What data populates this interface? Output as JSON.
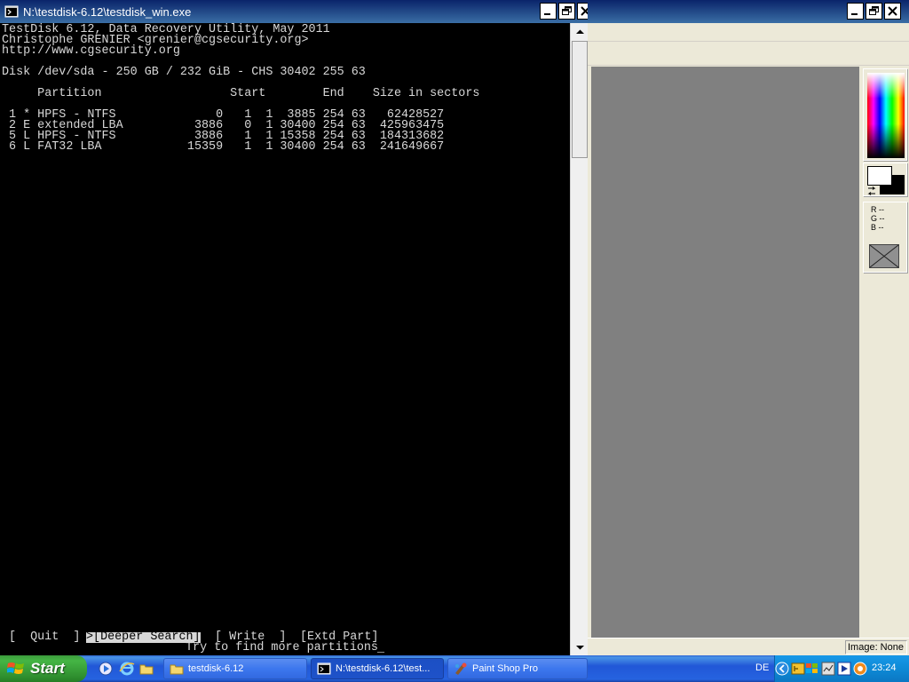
{
  "console": {
    "title": "N:\\testdisk-6.12\\testdisk_win.exe",
    "lines": [
      "TestDisk 6.12, Data Recovery Utility, May 2011",
      "Christophe GRENIER <grenier@cgsecurity.org>",
      "http://www.cgsecurity.org",
      "",
      "Disk /dev/sda - 250 GB / 232 GiB - CHS 30402 255 63",
      "",
      "     Partition                  Start        End    Size in sectors",
      "",
      " 1 * HPFS - NTFS              0   1  1  3885 254 63   62428527",
      " 2 E extended LBA          3886   0  1 30400 254 63  425963475",
      " 5 L HPFS - NTFS           3886   1  1 15358 254 63  184313682",
      " 6 L FAT32 LBA            15359   1  1 30400 254 63  241649667"
    ],
    "menu": {
      "quit": "[  Quit  ]",
      "deeper_search": ">[Deeper Search]",
      "write": "[ Write  ]",
      "extd_part": "[Extd Part]"
    },
    "hint": "Try to find more partitions",
    "cursor": "_"
  },
  "psp": {
    "status_image": "Image: None",
    "rgb": {
      "r": "R --",
      "g": "G --",
      "b": "B --"
    },
    "foreground": "#ffffff",
    "background": "#000000"
  },
  "taskbar": {
    "start_label": "Start",
    "tasks": [
      {
        "label": "testdisk-6.12",
        "icon": "folder-icon"
      },
      {
        "label": "N:\\testdisk-6.12\\test...",
        "icon": "console-icon"
      },
      {
        "label": "Paint Shop Pro",
        "icon": "paint-shop-pro-icon"
      }
    ],
    "language": "DE",
    "clock": "23:24"
  }
}
